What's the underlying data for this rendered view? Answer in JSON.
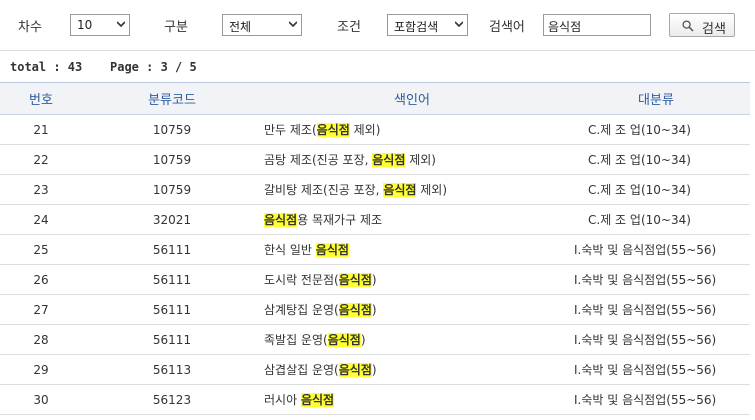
{
  "search": {
    "round_label": "차수",
    "round_value": "10",
    "category_label": "구분",
    "category_value": "전체",
    "condition_label": "조건",
    "condition_value": "포함검색",
    "keyword_label": "검색어",
    "keyword_value": "음식점",
    "button_label": "검색"
  },
  "summary": {
    "total": "total : 43",
    "page": "Page : 3 / 5"
  },
  "table": {
    "headers": [
      "번호",
      "분류코드",
      "색인어",
      "대분류"
    ],
    "highlight_word": "음식점",
    "rows": [
      {
        "no": "21",
        "code": "10759",
        "pre": "만두 제조(",
        "hl": "음식점",
        "post": " 제외)",
        "major": "C.제 조 업(10~34)"
      },
      {
        "no": "22",
        "code": "10759",
        "pre": "곰탕 제조(진공 포장, ",
        "hl": "음식점",
        "post": " 제외)",
        "major": "C.제 조 업(10~34)"
      },
      {
        "no": "23",
        "code": "10759",
        "pre": "갈비탕 제조(진공 포장, ",
        "hl": "음식점",
        "post": " 제외)",
        "major": "C.제 조 업(10~34)"
      },
      {
        "no": "24",
        "code": "32021",
        "pre": "",
        "hl": "음식점",
        "post": "용 목재가구 제조",
        "major": "C.제 조 업(10~34)"
      },
      {
        "no": "25",
        "code": "56111",
        "pre": "한식 일반 ",
        "hl": "음식점",
        "post": "",
        "major": "I.숙박 및 음식점업(55~56)"
      },
      {
        "no": "26",
        "code": "56111",
        "pre": "도시락 전문점(",
        "hl": "음식점",
        "post": ")",
        "major": "I.숙박 및 음식점업(55~56)"
      },
      {
        "no": "27",
        "code": "56111",
        "pre": "삼계탕집 운영(",
        "hl": "음식점",
        "post": ")",
        "major": "I.숙박 및 음식점업(55~56)"
      },
      {
        "no": "28",
        "code": "56111",
        "pre": "족발집 운영(",
        "hl": "음식점",
        "post": ")",
        "major": "I.숙박 및 음식점업(55~56)"
      },
      {
        "no": "29",
        "code": "56113",
        "pre": "삼겹살집 운영(",
        "hl": "음식점",
        "post": ")",
        "major": "I.숙박 및 음식점업(55~56)"
      },
      {
        "no": "30",
        "code": "56123",
        "pre": "러시아 ",
        "hl": "음식점",
        "post": "",
        "major": "I.숙박 및 음식점업(55~56)"
      }
    ]
  },
  "colors": {
    "header_text": "#2e5c9e",
    "header_bg": "#f1f3f7",
    "highlight": "#ffff33"
  },
  "icons": {
    "dropdown": "chevron-down-icon",
    "search": "search-icon"
  }
}
